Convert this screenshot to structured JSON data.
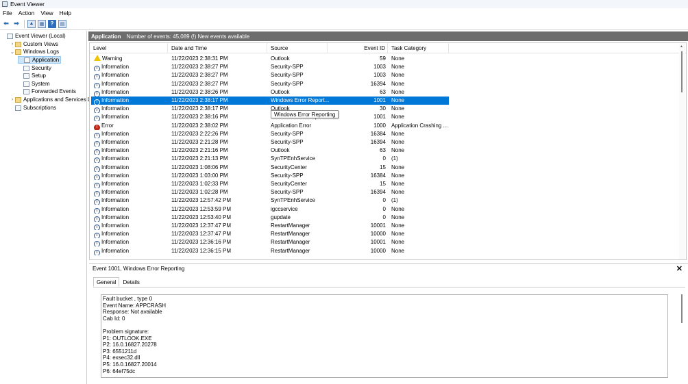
{
  "window": {
    "title": "Event Viewer"
  },
  "menu": [
    "File",
    "Action",
    "View",
    "Help"
  ],
  "tree": [
    {
      "label": "Event Viewer (Local)",
      "exp": "",
      "level": 0,
      "icon": "log"
    },
    {
      "label": "Custom Views",
      "exp": "›",
      "level": 1,
      "icon": "folder"
    },
    {
      "label": "Windows Logs",
      "exp": "⌄",
      "level": 1,
      "icon": "folder"
    },
    {
      "label": "Application",
      "exp": "",
      "level": 2,
      "icon": "log",
      "selected": true
    },
    {
      "label": "Security",
      "exp": "",
      "level": 2,
      "icon": "log"
    },
    {
      "label": "Setup",
      "exp": "",
      "level": 2,
      "icon": "log"
    },
    {
      "label": "System",
      "exp": "",
      "level": 2,
      "icon": "log"
    },
    {
      "label": "Forwarded Events",
      "exp": "",
      "level": 2,
      "icon": "log"
    },
    {
      "label": "Applications and Services Lo",
      "exp": "›",
      "level": 1,
      "icon": "folder"
    },
    {
      "label": "Subscriptions",
      "exp": "",
      "level": 1,
      "icon": "log"
    }
  ],
  "main": {
    "title": "Application",
    "summary": "Number of events: 45,089 (!) New events available"
  },
  "grid": {
    "columns": [
      "Level",
      "Date and Time",
      "Source",
      "Event ID",
      "Task Category"
    ],
    "rows": [
      {
        "level": "Warning",
        "type": "warn",
        "date": "11/22/2023 2:38:31 PM",
        "source": "Outlook",
        "id": "59",
        "cat": "None"
      },
      {
        "level": "Information",
        "type": "info",
        "date": "11/22/2023 2:38:27 PM",
        "source": "Security-SPP",
        "id": "1003",
        "cat": "None"
      },
      {
        "level": "Information",
        "type": "info",
        "date": "11/22/2023 2:38:27 PM",
        "source": "Security-SPP",
        "id": "1003",
        "cat": "None"
      },
      {
        "level": "Information",
        "type": "info",
        "date": "11/22/2023 2:38:27 PM",
        "source": "Security-SPP",
        "id": "16394",
        "cat": "None"
      },
      {
        "level": "Information",
        "type": "info",
        "date": "11/22/2023 2:38:26 PM",
        "source": "Outlook",
        "id": "63",
        "cat": "None"
      },
      {
        "level": "Information",
        "type": "info",
        "date": "11/22/2023 2:38:17 PM",
        "source": "Windows Error Report...",
        "id": "1001",
        "cat": "None",
        "selected": true
      },
      {
        "level": "Information",
        "type": "info",
        "date": "11/22/2023 2:38:17 PM",
        "source": "Outlook",
        "id": "30",
        "cat": "None"
      },
      {
        "level": "Information",
        "type": "info",
        "date": "11/22/2023 2:38:16 PM",
        "source": "Windows Error Reporting",
        "id": "1001",
        "cat": "None"
      },
      {
        "level": "Error",
        "type": "err",
        "date": "11/22/2023 2:38:02 PM",
        "source": "Application Error",
        "id": "1000",
        "cat": "Application Crashing ..."
      },
      {
        "level": "Information",
        "type": "info",
        "date": "11/22/2023 2:22:26 PM",
        "source": "Security-SPP",
        "id": "16384",
        "cat": "None"
      },
      {
        "level": "Information",
        "type": "info",
        "date": "11/22/2023 2:21:28 PM",
        "source": "Security-SPP",
        "id": "16394",
        "cat": "None"
      },
      {
        "level": "Information",
        "type": "info",
        "date": "11/22/2023 2:21:16 PM",
        "source": "Outlook",
        "id": "63",
        "cat": "None"
      },
      {
        "level": "Information",
        "type": "info",
        "date": "11/22/2023 2:21:13 PM",
        "source": "SynTPEnhService",
        "id": "0",
        "cat": "(1)"
      },
      {
        "level": "Information",
        "type": "info",
        "date": "11/22/2023 1:08:06 PM",
        "source": "SecurityCenter",
        "id": "15",
        "cat": "None"
      },
      {
        "level": "Information",
        "type": "info",
        "date": "11/22/2023 1:03:00 PM",
        "source": "Security-SPP",
        "id": "16384",
        "cat": "None"
      },
      {
        "level": "Information",
        "type": "info",
        "date": "11/22/2023 1:02:33 PM",
        "source": "SecurityCenter",
        "id": "15",
        "cat": "None"
      },
      {
        "level": "Information",
        "type": "info",
        "date": "11/22/2023 1:02:28 PM",
        "source": "Security-SPP",
        "id": "16394",
        "cat": "None"
      },
      {
        "level": "Information",
        "type": "info",
        "date": "11/22/2023 12:57:42 PM",
        "source": "SynTPEnhService",
        "id": "0",
        "cat": "(1)"
      },
      {
        "level": "Information",
        "type": "info",
        "date": "11/22/2023 12:53:59 PM",
        "source": "igccservice",
        "id": "0",
        "cat": "None"
      },
      {
        "level": "Information",
        "type": "info",
        "date": "11/22/2023 12:53:40 PM",
        "source": "gupdate",
        "id": "0",
        "cat": "None"
      },
      {
        "level": "Information",
        "type": "info",
        "date": "11/22/2023 12:37:47 PM",
        "source": "RestartManager",
        "id": "10001",
        "cat": "None"
      },
      {
        "level": "Information",
        "type": "info",
        "date": "11/22/2023 12:37:47 PM",
        "source": "RestartManager",
        "id": "10000",
        "cat": "None"
      },
      {
        "level": "Information",
        "type": "info",
        "date": "11/22/2023 12:36:16 PM",
        "source": "RestartManager",
        "id": "10001",
        "cat": "None"
      },
      {
        "level": "Information",
        "type": "info",
        "date": "11/22/2023 12:36:15 PM",
        "source": "RestartManager",
        "id": "10000",
        "cat": "None"
      }
    ],
    "tooltip": "Windows Error Reporting"
  },
  "detail": {
    "title": "Event 1001, Windows Error Reporting",
    "tabs": [
      "General",
      "Details"
    ],
    "lines": [
      "Fault bucket , type 0",
      "Event Name: APPCRASH",
      "Response: Not available",
      "Cab Id: 0",
      "",
      "Problem signature:",
      "P1: OUTLOOK.EXE",
      "P2: 16.0.16827.20278",
      "P3: 6551211d",
      "P4: exsec32.dll",
      "P5: 16.0.16827.20014",
      "P6: 64ef75dc"
    ]
  }
}
